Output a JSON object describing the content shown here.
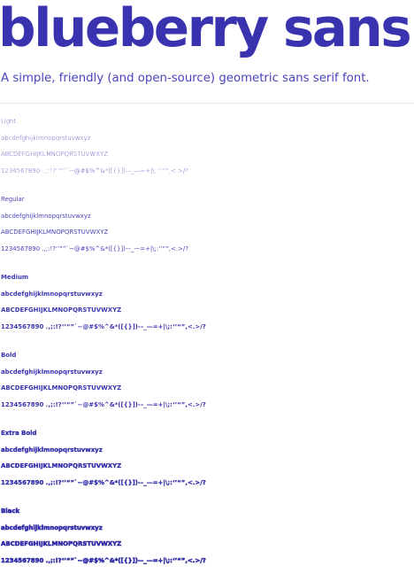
{
  "header": {
    "title": "blueberry sans",
    "subtitle": "A simple, friendly (and open-source) geometric sans serif font."
  },
  "samples": [
    {
      "name": "Light",
      "lowercase": "abcdefghijklmnopqrstuvwxyz",
      "uppercase": "ABCDEFGHIJKLMNOPQRSTUVWXYZ",
      "digits": "1234567890 .,;:!?‘’“”`~@#$%^&*([{}])-–_—=+|\\;:‘’“”,<.>/?"
    },
    {
      "name": "Regular",
      "lowercase": "abcdefghijklmnopqrstuvwxyz",
      "uppercase": "ABCDEFGHIJKLMNOPQRSTUVWXYZ",
      "digits": "1234567890 .,;:!?‘’“”`~@#$%^&*([{}])-–_—=+|\\;:‘’“”,<.>/?"
    },
    {
      "name": "Medium",
      "lowercase": "abcdefghijklmnopqrstuvwxyz",
      "uppercase": "ABCDEFGHIJKLMNOPQRSTUVWXYZ",
      "digits": "1234567890 .,;:!?‘’“”`~@#$%^&*([{}])-–_—=+|\\;:‘’“”,<.>/?"
    },
    {
      "name": "Bold",
      "lowercase": "abcdefghijklmnopqrstuvwxyz",
      "uppercase": "ABCDEFGHIJKLMNOPQRSTUVWXYZ",
      "digits": "1234567890 .,;:!?‘’“”`~@#$%^&*([{}])-–_—=+|\\;:‘’“”,<.>/?"
    },
    {
      "name": "Extra Bold",
      "lowercase": "abcdefghijklmnopqrstuvwxyz",
      "uppercase": "ABCDEFGHIJKLMNOPQRSTUVWXYZ",
      "digits": "1234567890 .,;:!?‘’“”`~@#$%^&*([{}])-–_—=+|\\;:‘’“”,<.>/?"
    },
    {
      "name": "Black",
      "lowercase": "abcdefghijklmnopqrstuvwxyz",
      "uppercase": "ABCDEFGHIJKLMNOPQRSTUVWXYZ",
      "digits": "1234567890 .,;:!?‘’“”`~@#$%^&*([{}])-–_—=+|\\;:‘’“”,<.>/?"
    }
  ],
  "colors": {
    "accent": "#3a33b0",
    "background": "#ffffff",
    "divider": "#e6e6ee"
  }
}
